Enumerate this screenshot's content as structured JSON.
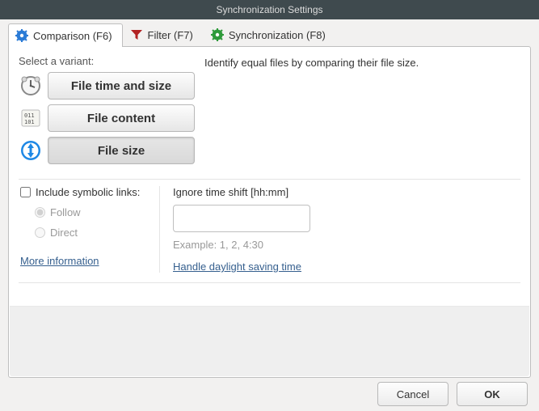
{
  "window": {
    "title": "Synchronization Settings"
  },
  "tabs": {
    "comparison": "Comparison (F6)",
    "filter": "Filter (F7)",
    "synchronization": "Synchronization (F8)"
  },
  "variant": {
    "select_label": "Select a variant:",
    "time_size": "File time and size",
    "content": "File content",
    "size": "File size"
  },
  "description": "Identify equal files by comparing their file size.",
  "symlinks": {
    "include": "Include symbolic links:",
    "follow": "Follow",
    "direct": "Direct",
    "more_info": "More information"
  },
  "timeshift": {
    "label": "Ignore time shift [hh:mm]",
    "value": "",
    "example": "Example:  1, 2, 4:30",
    "dst_link": "Handle daylight saving time"
  },
  "buttons": {
    "cancel": "Cancel",
    "ok": "OK"
  }
}
